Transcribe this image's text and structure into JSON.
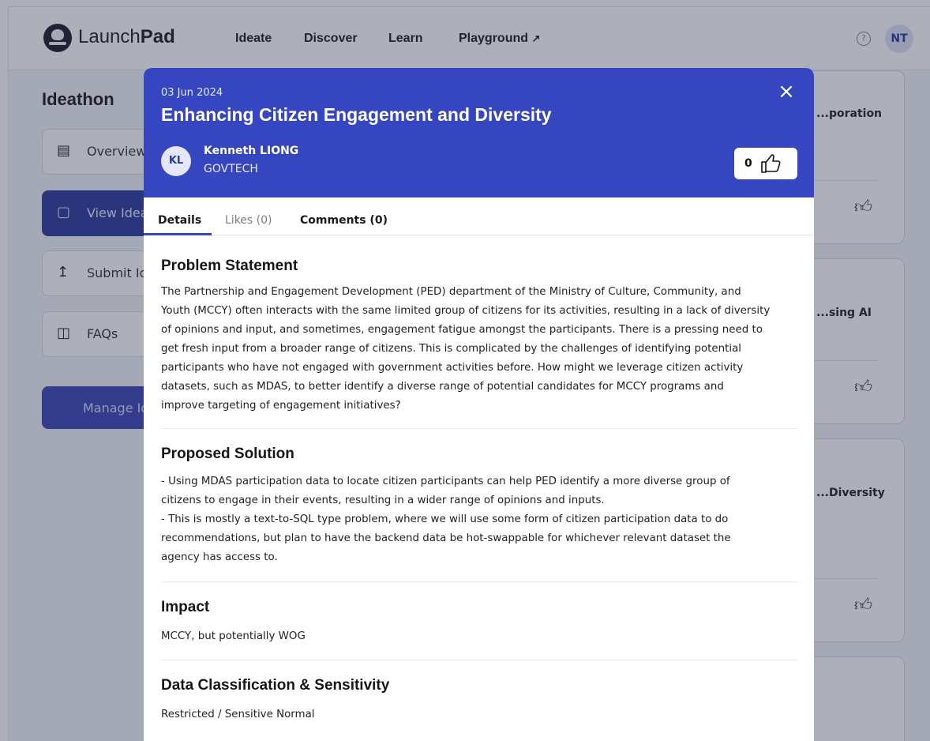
{
  "app": {
    "logo_light": "Launch",
    "logo_bold": "Pad",
    "nav": [
      "Ideate",
      "Discover",
      "Learn",
      "Playground"
    ],
    "user_initials": "NT"
  },
  "sidebar": {
    "title": "Ideathon",
    "items": [
      {
        "label": "Overview",
        "icon": "document-icon"
      },
      {
        "label": "View Ideas",
        "icon": "board-icon"
      },
      {
        "label": "Submit Idea",
        "icon": "upload-icon"
      },
      {
        "label": "FAQs",
        "icon": "chat-icon"
      }
    ],
    "manage_label": "Manage Ideas"
  },
  "cards": [
    {
      "title": "...poration"
    },
    {
      "title": "...sing AI"
    },
    {
      "title": "...Diversity"
    }
  ],
  "modal": {
    "date": "03 Jun 2024",
    "title": "Enhancing Citizen Engagement and Diversity",
    "author_initials": "KL",
    "author": "Kenneth LIONG",
    "agency": "GOVTECH",
    "likes": "0",
    "tabs": {
      "details": "Details",
      "likes": "Likes (0)",
      "comments": "Comments (0)"
    },
    "sections": [
      {
        "heading": "Problem Statement",
        "text": "The Partnership and Engagement Development (PED) department of the Ministry of Culture, Community, and\nYouth (MCCY) often interacts with the same limited group of citizens for its activities, resulting in a lack of diversity\nof opinions and input, and sometimes, engagement fatigue amongst the participants. There is a pressing need to\nget fresh input from a broader range of citizens. This is complicated by the challenges of identifying potential\nparticipants who have not engaged with government activities before. How might we leverage citizen activity\ndatasets, such as MDAS, to better identify a diverse range of potential candidates for MCCY programs and\nimprove targeting of engagement initiatives?"
      },
      {
        "heading": "Proposed Solution",
        "text": "- Using MDAS participation data to locate citizen participants can help PED identify a more diverse group of\ncitizens to engage in their events, resulting in a wider range of opinions and inputs.\n- This is mostly a text-to-SQL type problem, where we will use some form of citizen participation data to do\nrecommendations, but plan to have the backend data be hot-swappable for whichever relevant dataset the\nagency has access to."
      },
      {
        "heading": "Impact",
        "text": "MCCY, but potentially WOG"
      },
      {
        "heading": "Data Classification & Sensitivity",
        "text": "Restricted / Sensitive Normal"
      }
    ]
  },
  "colors": {
    "brand": "#3646c0",
    "brand_dark": "#2e3a9c"
  }
}
